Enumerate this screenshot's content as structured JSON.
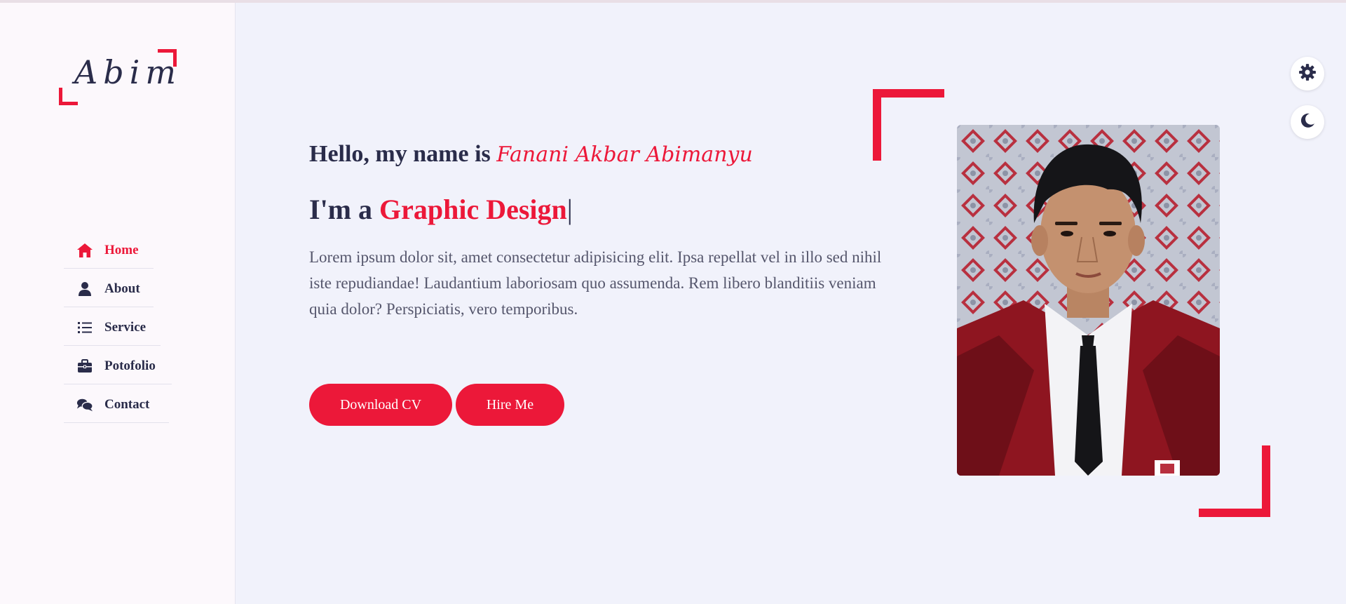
{
  "logo": {
    "text": "Abim"
  },
  "nav": {
    "items": [
      {
        "label": "Home",
        "icon": "home-icon",
        "active": true
      },
      {
        "label": "About",
        "icon": "user-icon",
        "active": false
      },
      {
        "label": "Service",
        "icon": "list-icon",
        "active": false
      },
      {
        "label": "Potofolio",
        "icon": "briefcase-icon",
        "active": false
      },
      {
        "label": "Contact",
        "icon": "comments-icon",
        "active": false
      }
    ]
  },
  "hero": {
    "greeting_prefix": "Hello, my name is",
    "name": "Fanani Akbar Abimanyu",
    "role_prefix": "I'm a",
    "role": "Graphic Design",
    "cursor": "|",
    "description": "Lorem ipsum dolor sit, amet consectetur adipisicing elit. Ipsa repellat vel in illo sed nihil iste repudiandae! Laudantium laboriosam quo assumenda. Rem libero blanditiis veniam quia dolor? Perspiciatis, vero temporibus.",
    "download_cv_label": "Download CV",
    "hire_me_label": "Hire Me"
  },
  "side_buttons": {
    "settings_icon": "gear-icon",
    "theme_icon": "moon-icon"
  },
  "colors": {
    "accent": "#ec1839",
    "dark": "#2a2c4a",
    "bg": "#f1f2fb",
    "sidebar_bg": "#fcf8fc"
  }
}
